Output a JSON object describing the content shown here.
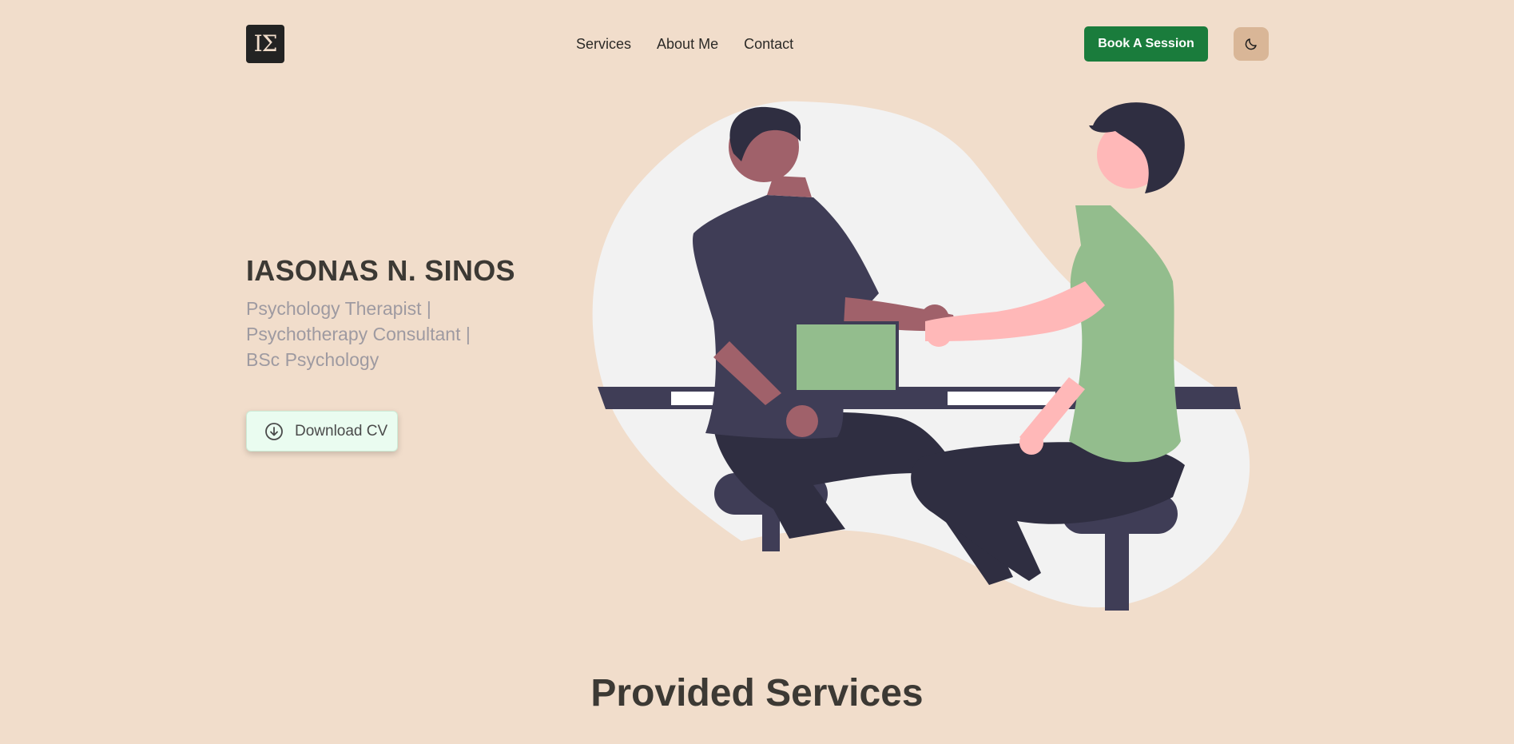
{
  "header": {
    "logo_text": "IΣ",
    "nav": [
      {
        "label": "Services"
      },
      {
        "label": "About Me"
      },
      {
        "label": "Contact"
      }
    ],
    "cta_label": "Book A Session",
    "theme_toggle_icon": "moon-icon"
  },
  "hero": {
    "name": "IASONAS N. SINOS",
    "subtitle_lines": [
      "Psychology Therapist |",
      "Psychotherapy Consultant |",
      "BSc Psychology"
    ],
    "download_label": "Download CV",
    "download_icon": "download-circle-icon",
    "illustration": "two-people-handshake-over-desk-illustration"
  },
  "services": {
    "title": "Provided Services"
  },
  "colors": {
    "background": "#f1ddcb",
    "primary_green": "#1a7c3c",
    "theme_toggle_bg": "#d9b697",
    "download_bg": "#eafcf0",
    "heading": "#3c3934",
    "subtitle": "#9e9aa1",
    "blob": "#f2f2f2",
    "dark_figure": "#3f3d56",
    "shirt_green": "#93bd8d",
    "skin_pink": "#ffb8b8",
    "skin_brown": "#a0616a"
  }
}
